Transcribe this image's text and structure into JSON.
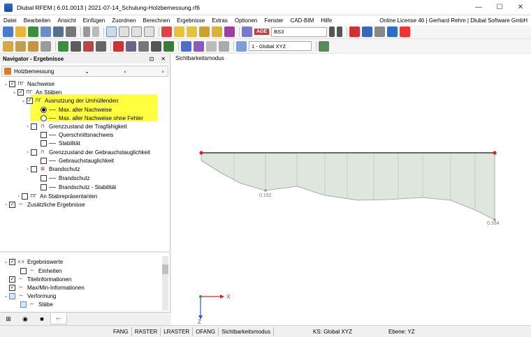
{
  "window": {
    "title": "Dlubal RFEM | 6.01.0013 | 2021-07-14_Schulung-Holzbemessung.rf6",
    "controls": [
      "—",
      "☐",
      "✕"
    ]
  },
  "menu": {
    "items": [
      "Datei",
      "Bearbeiten",
      "Ansicht",
      "Einfügen",
      "Zuordnen",
      "Berechnen",
      "Ergebnisse",
      "Extras",
      "Optionen",
      "Fenster",
      "CAD-BIM",
      "Hilfe"
    ],
    "license": "Online License 46 | Gerhard Rehm | Dlubal Software GmbH"
  },
  "toolbar": {
    "loadcase_badge": "AGE",
    "loadcase_value": "BS3",
    "coord_system": "1 - Global XYZ"
  },
  "navigator": {
    "title": "Navigator - Ergebnisse",
    "dropdown": "Holzbemessung",
    "tree": {
      "nachweise": "Nachweise",
      "an_staeben": "An Stäben",
      "ausnutzung": "Ausnutzung der Umhüllenden",
      "max_aller": "Max. aller Nachweise",
      "max_ohne_fehler": "Max. aller Nachweise ohne Fehler",
      "gzt": "Grenzzustand der Tragfähigkeit",
      "querschnitt": "Querschnittsnachweis",
      "stabilitaet": "Stabilität",
      "gzg": "Grenzzustand der Gebrauchstauglichkeit",
      "gebrauch": "Gebrauchstauglichkeit",
      "brandschutz": "Brandschutz",
      "brandschutz_sub": "Brandschutz",
      "brandschutz_stab": "Brandschutz - Stabilität",
      "stabrep": "An Stabrepräsentanten",
      "zusaetzlich": "Zusätzliche Ergebnisse"
    },
    "lower_tree": {
      "ergebniswerte": "Ergebniswerte",
      "einheiten": "Einheiten",
      "titelinfo": "Titelinformationen",
      "maxmin": "Max/Min-Informationen",
      "verformung": "Verformung",
      "staebe": "Stäbe"
    }
  },
  "view": {
    "title": "Sichtbarkeitsmodus",
    "labels": {
      "value1": "0.192",
      "value2": "0.334"
    },
    "axes": {
      "x": "X",
      "z": "Z"
    },
    "colors": {
      "fill": "#dfe6dd",
      "stroke": "#8f9f8f",
      "beam": "#3a3a3a",
      "node": "#e02020"
    }
  },
  "status": {
    "buttons": [
      "FANG",
      "RASTER",
      "LRASTER",
      "OFANG",
      "Sichtbarkeitsmodus"
    ],
    "ks": "KS: Global XYZ",
    "ebene": "Ebene: YZ"
  }
}
